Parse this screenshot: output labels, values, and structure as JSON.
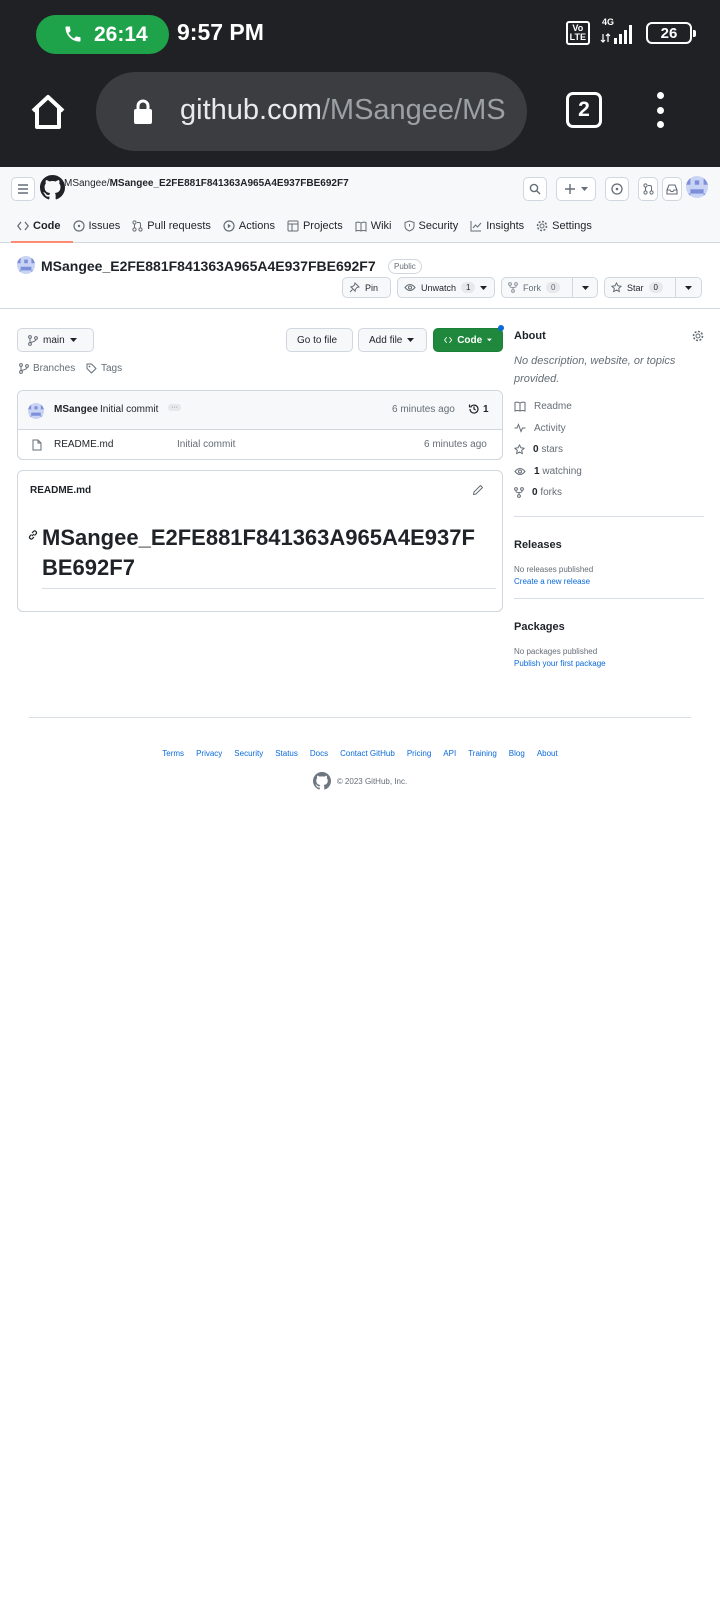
{
  "status_bar": {
    "call_timer": "26:14",
    "time": "9:57 PM",
    "volte_label": "Vo\nLTE",
    "network": "4G",
    "battery": "26"
  },
  "browser": {
    "url_host": "github.com",
    "url_path": "/MSangee/MS",
    "tab_count": "2"
  },
  "header": {
    "owner": "MSangee",
    "separator": "/",
    "repo": "MSangee_E2FE881F841363A965A4E937FBE692F7"
  },
  "nav": [
    {
      "label": "Code",
      "icon": "code-icon"
    },
    {
      "label": "Issues",
      "icon": "issue-icon"
    },
    {
      "label": "Pull requests",
      "icon": "pull-request-icon"
    },
    {
      "label": "Actions",
      "icon": "play-icon"
    },
    {
      "label": "Projects",
      "icon": "table-icon"
    },
    {
      "label": "Wiki",
      "icon": "book-icon"
    },
    {
      "label": "Security",
      "icon": "shield-icon"
    },
    {
      "label": "Insights",
      "icon": "graph-icon"
    },
    {
      "label": "Settings",
      "icon": "gear-icon"
    }
  ],
  "repo": {
    "title": "MSangee_E2FE881F841363A965A4E937FBE692F7",
    "visibility": "Public",
    "pin_label": "Pin",
    "unwatch_label": "Unwatch",
    "watch_count": "1",
    "fork_label": "Fork",
    "fork_count": "0",
    "star_label": "Star",
    "star_count": "0"
  },
  "toolbar": {
    "branch": "main",
    "goto_file": "Go to file",
    "add_file": "Add file",
    "code": "Code",
    "branches": "Branches",
    "tags": "Tags"
  },
  "commit": {
    "author": "MSangee",
    "message": "Initial commit",
    "ellipsis": "···",
    "time": "6 minutes ago",
    "count": "1"
  },
  "files": [
    {
      "name": "README.md",
      "message": "Initial commit",
      "time": "6 minutes ago"
    }
  ],
  "readme": {
    "filename": "README.md",
    "heading": "MSangee_E2FE881F841363A965A4E937FBE692F7"
  },
  "about": {
    "title": "About",
    "description": "No description, website, or topics provided.",
    "readme": "Readme",
    "activity": "Activity",
    "stars_count": "0",
    "stars_label": "stars",
    "watching_count": "1",
    "watching_label": "watching",
    "forks_count": "0",
    "forks_label": "forks"
  },
  "releases": {
    "title": "Releases",
    "empty": "No releases published",
    "link": "Create a new release"
  },
  "packages": {
    "title": "Packages",
    "empty": "No packages published",
    "link": "Publish your first package"
  },
  "footer": {
    "links": [
      "Terms",
      "Privacy",
      "Security",
      "Status",
      "Docs",
      "Contact GitHub",
      "Pricing",
      "API",
      "Training",
      "Blog",
      "About"
    ],
    "copyright": "© 2023 GitHub, Inc."
  },
  "colors": {
    "chrome_bg": "#202124",
    "call_green": "#1fa34a",
    "code_button": "#1f883d",
    "link_blue": "#0969da",
    "nav_underline": "#fd8c73"
  }
}
